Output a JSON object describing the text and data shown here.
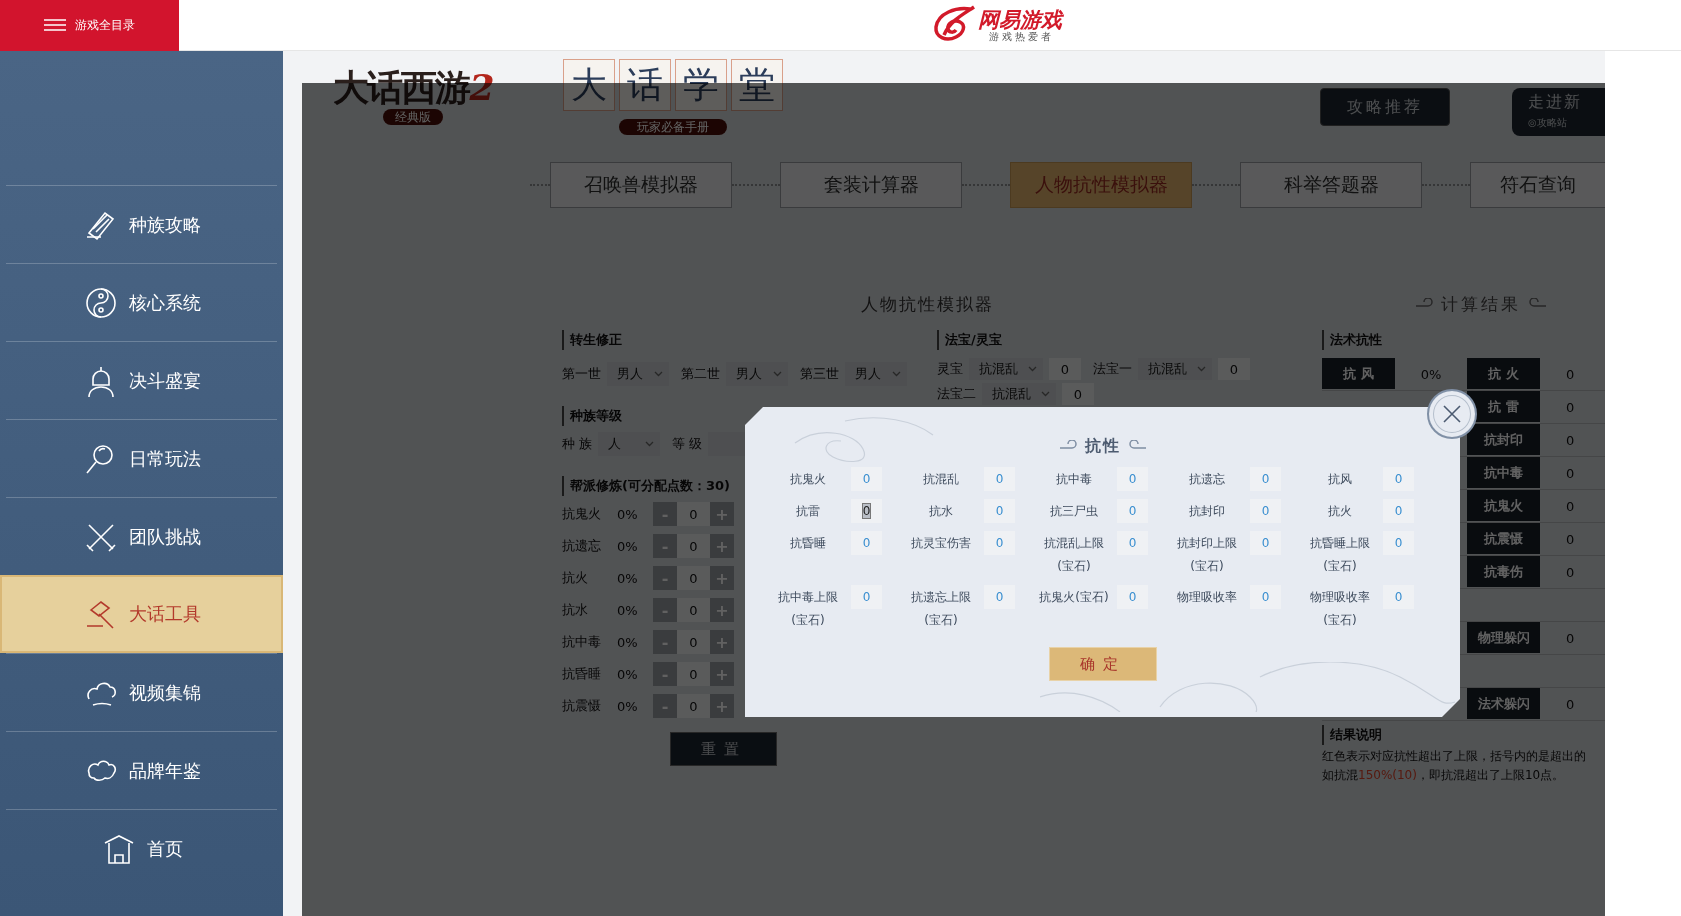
{
  "header": {
    "menu_button": "游戏全目录",
    "logo_text": "网易游戏",
    "logo_tagline": "游 戏 热 爱 者"
  },
  "sidebar": {
    "items": [
      {
        "label": "种族攻略",
        "selected": false
      },
      {
        "label": "核心系统",
        "selected": false
      },
      {
        "label": "决斗盛宴",
        "selected": false
      },
      {
        "label": "日常玩法",
        "selected": false
      },
      {
        "label": "团队挑战",
        "selected": false
      },
      {
        "label": "大话工具",
        "selected": true
      },
      {
        "label": "视频集锦",
        "selected": false
      },
      {
        "label": "品牌年鉴",
        "selected": false
      },
      {
        "label": "首页",
        "selected": false
      }
    ]
  },
  "banner": {
    "game_logo": "大话西游",
    "game_logo_numeral": "2",
    "game_edition": "经典版",
    "school_title": [
      "大",
      "话",
      "学",
      "堂"
    ],
    "school_subtitle": "玩家必备手册",
    "guide_button": "攻略推荐",
    "new_server": {
      "title": "走进新",
      "tag": "◎攻略站"
    }
  },
  "tabs": [
    {
      "label": "召唤兽模拟器",
      "selected": false
    },
    {
      "label": "套装计算器",
      "selected": false
    },
    {
      "label": "人物抗性模拟器",
      "selected": true
    },
    {
      "label": "科举答题器",
      "selected": false
    },
    {
      "label": "符石查询",
      "selected": false
    }
  ],
  "simulator": {
    "title": "人物抗性模拟器",
    "rebirth": {
      "heading": "转生修正",
      "lives": [
        {
          "label": "第一世",
          "value": "男人"
        },
        {
          "label": "第二世",
          "value": "男人"
        },
        {
          "label": "第三世",
          "value": "男人"
        }
      ]
    },
    "race": {
      "heading": "种族等级",
      "race_label": "种 族",
      "race_value": "人",
      "level_label": "等 级"
    },
    "guild": {
      "heading": "帮派修炼(可分配点数：30)",
      "rows": [
        {
          "label": "抗鬼火",
          "percent": "0%",
          "minus": "-",
          "value": "0",
          "plus": "+"
        },
        {
          "label": "抗遗忘",
          "percent": "0%",
          "minus": "-",
          "value": "0",
          "plus": "+"
        },
        {
          "label": "抗火",
          "percent": "0%",
          "minus": "-",
          "value": "0",
          "plus": "+"
        },
        {
          "label": "抗水",
          "percent": "0%",
          "minus": "-",
          "value": "0",
          "plus": "+"
        },
        {
          "label": "抗中毒",
          "percent": "0%",
          "minus": "-",
          "value": "0",
          "plus": "+"
        },
        {
          "label": "抗昏睡",
          "percent": "0%",
          "minus": "-",
          "value": "0",
          "plus": "+"
        },
        {
          "label": "抗震慑",
          "percent": "0%",
          "minus": "-",
          "value": "0",
          "plus": "+"
        }
      ]
    },
    "reset_button": "重置",
    "treasure": {
      "heading": "法宝/灵宝",
      "rows": [
        [
          {
            "label": "灵宝",
            "value": "抗混乱",
            "amount": "0"
          },
          {
            "label": "法宝一",
            "value": "抗混乱",
            "amount": "0"
          }
        ],
        [
          {
            "label": "法宝二",
            "value": "抗混乱",
            "amount": "0"
          }
        ]
      ]
    },
    "results": {
      "title": "计算结果",
      "heading": "法术抗性",
      "rows": [
        {
          "kind": "pair",
          "left": {
            "label": "抗 风",
            "value": "0%"
          },
          "right": {
            "label": "抗 火",
            "value": "0"
          }
        },
        {
          "kind": "pair",
          "right": {
            "label": "抗 雷",
            "value": "0"
          }
        },
        {
          "kind": "pair",
          "right": {
            "label": "抗封印",
            "value": "0"
          }
        },
        {
          "kind": "pair",
          "right": {
            "label": "抗中毒",
            "value": "0"
          }
        },
        {
          "kind": "pair",
          "right": {
            "label": "抗鬼火",
            "value": "0"
          }
        },
        {
          "kind": "pair",
          "right": {
            "label": "抗震慑",
            "value": "0"
          }
        },
        {
          "kind": "pair",
          "right": {
            "label": "抗毒伤",
            "value": "0"
          }
        },
        {
          "kind": "spacer"
        },
        {
          "kind": "pair",
          "right": {
            "label": "物理躲闪",
            "value": "0"
          }
        },
        {
          "kind": "spacer"
        },
        {
          "kind": "pair",
          "right": {
            "label": "法术躲闪",
            "value": "0"
          }
        }
      ]
    },
    "note": {
      "heading": "结果说明",
      "lines": [
        [
          {
            "text": "红色表示对应抗性超出了上限，括号内的是超出的",
            "kind": "plain"
          }
        ],
        [
          {
            "text": "如抗混",
            "kind": "plain"
          },
          {
            "text": "150%(10)",
            "kind": "over"
          },
          {
            "text": "，即抗混超出了上限10点。",
            "kind": "plain"
          }
        ]
      ]
    }
  },
  "modal": {
    "title": "抗性",
    "confirm_button": "确定",
    "fields": [
      {
        "label": "抗鬼火",
        "value": "0",
        "focused": false
      },
      {
        "label": "抗混乱",
        "value": "0",
        "focused": false
      },
      {
        "label": "抗中毒",
        "value": "0",
        "focused": false
      },
      {
        "label": "抗遗忘",
        "value": "0",
        "focused": false
      },
      {
        "label": "抗风",
        "value": "0",
        "focused": false
      },
      {
        "label": "抗雷",
        "value": "0",
        "focused": true
      },
      {
        "label": "抗水",
        "value": "0",
        "focused": false
      },
      {
        "label": "抗三尸虫",
        "value": "0",
        "focused": false
      },
      {
        "label": "抗封印",
        "value": "0",
        "focused": false
      },
      {
        "label": "抗火",
        "value": "0",
        "focused": false
      },
      {
        "label": "抗昏睡",
        "value": "0",
        "focused": false
      },
      {
        "label": "抗灵宝伤害",
        "value": "0",
        "focused": false
      },
      {
        "label": "抗混乱上限",
        "sublabel": "(宝石)",
        "value": "0",
        "focused": false
      },
      {
        "label": "抗封印上限",
        "sublabel": "(宝石)",
        "value": "0",
        "focused": false
      },
      {
        "label": "抗昏睡上限",
        "sublabel": "(宝石)",
        "value": "0",
        "focused": false
      },
      {
        "label": "抗中毒上限",
        "sublabel": "(宝石)",
        "value": "0",
        "focused": false
      },
      {
        "label": "抗遗忘上限",
        "sublabel": "(宝石)",
        "value": "0",
        "focused": false
      },
      {
        "label": "抗鬼火(宝石)",
        "value": "0",
        "focused": false
      },
      {
        "label": "物理吸收率",
        "value": "0",
        "focused": false
      },
      {
        "label": "物理吸收率",
        "sublabel": "(宝石)",
        "value": "0",
        "focused": false
      }
    ]
  }
}
